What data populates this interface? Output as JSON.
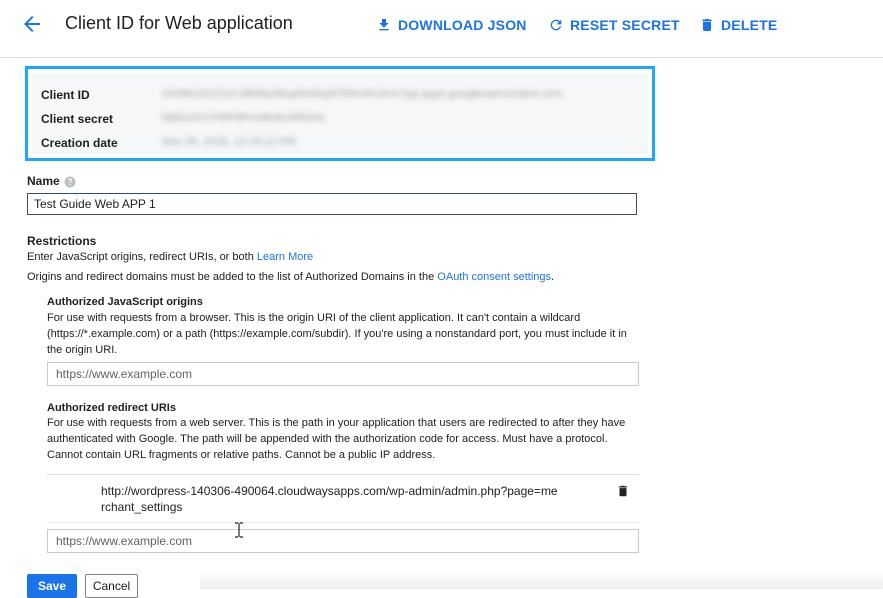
{
  "header": {
    "title": "Client ID for Web application",
    "actions": {
      "download_json": "DOWNLOAD JSON",
      "reset_secret": "RESET SECRET",
      "delete": "DELETE"
    }
  },
  "credentials": {
    "client_id_label": "Client ID",
    "client_id_value": "242961421513-l3khfqv5bup5o5iuj4l7b5m9m3rvc7pp.apps.googleusercontent.com",
    "client_secret_label": "Client secret",
    "client_secret_value": "hB9uOCCP8IF9PvxMOkvWh0Hx",
    "creation_date_label": "Creation date",
    "creation_date_value": "Nov 29, 2018, 12:19:12 PM"
  },
  "name_field": {
    "label": "Name",
    "value": "Test Guide Web APP 1"
  },
  "restrictions": {
    "title": "Restrictions",
    "hint": "Enter JavaScript origins, redirect URIs, or both",
    "learn_more": "Learn More",
    "note_prefix": "Origins and redirect domains must be added to the list of Authorized Domains in the",
    "oauth_link": "OAuth consent settings",
    "note_suffix": "."
  },
  "js_origins": {
    "title": "Authorized JavaScript origins",
    "description": "For use with requests from a browser. This is the origin URI of the client application. It can't contain a wildcard (https://*.example.com) or a path (https://example.com/subdir). If you're using a nonstandard port, you must include it in the origin URI.",
    "placeholder": "https://www.example.com"
  },
  "redirect_uris": {
    "title": "Authorized redirect URIs",
    "description": "For use with requests from a web server. This is the path in your application that users are redirected to after they have authenticated with Google. The path will be appended with the authorization code for access. Must have a protocol. Cannot contain URL fragments or relative paths. Cannot be a public IP address.",
    "items": [
      "http://wordpress-140306-490064.cloudwaysapps.com/wp-admin/admin.php?page=merchant_settings"
    ],
    "placeholder": "https://www.example.com"
  },
  "footer": {
    "save": "Save",
    "cancel": "Cancel"
  },
  "colors": {
    "accent": "#1a73e8",
    "highlight_border": "#1ea7fd"
  }
}
